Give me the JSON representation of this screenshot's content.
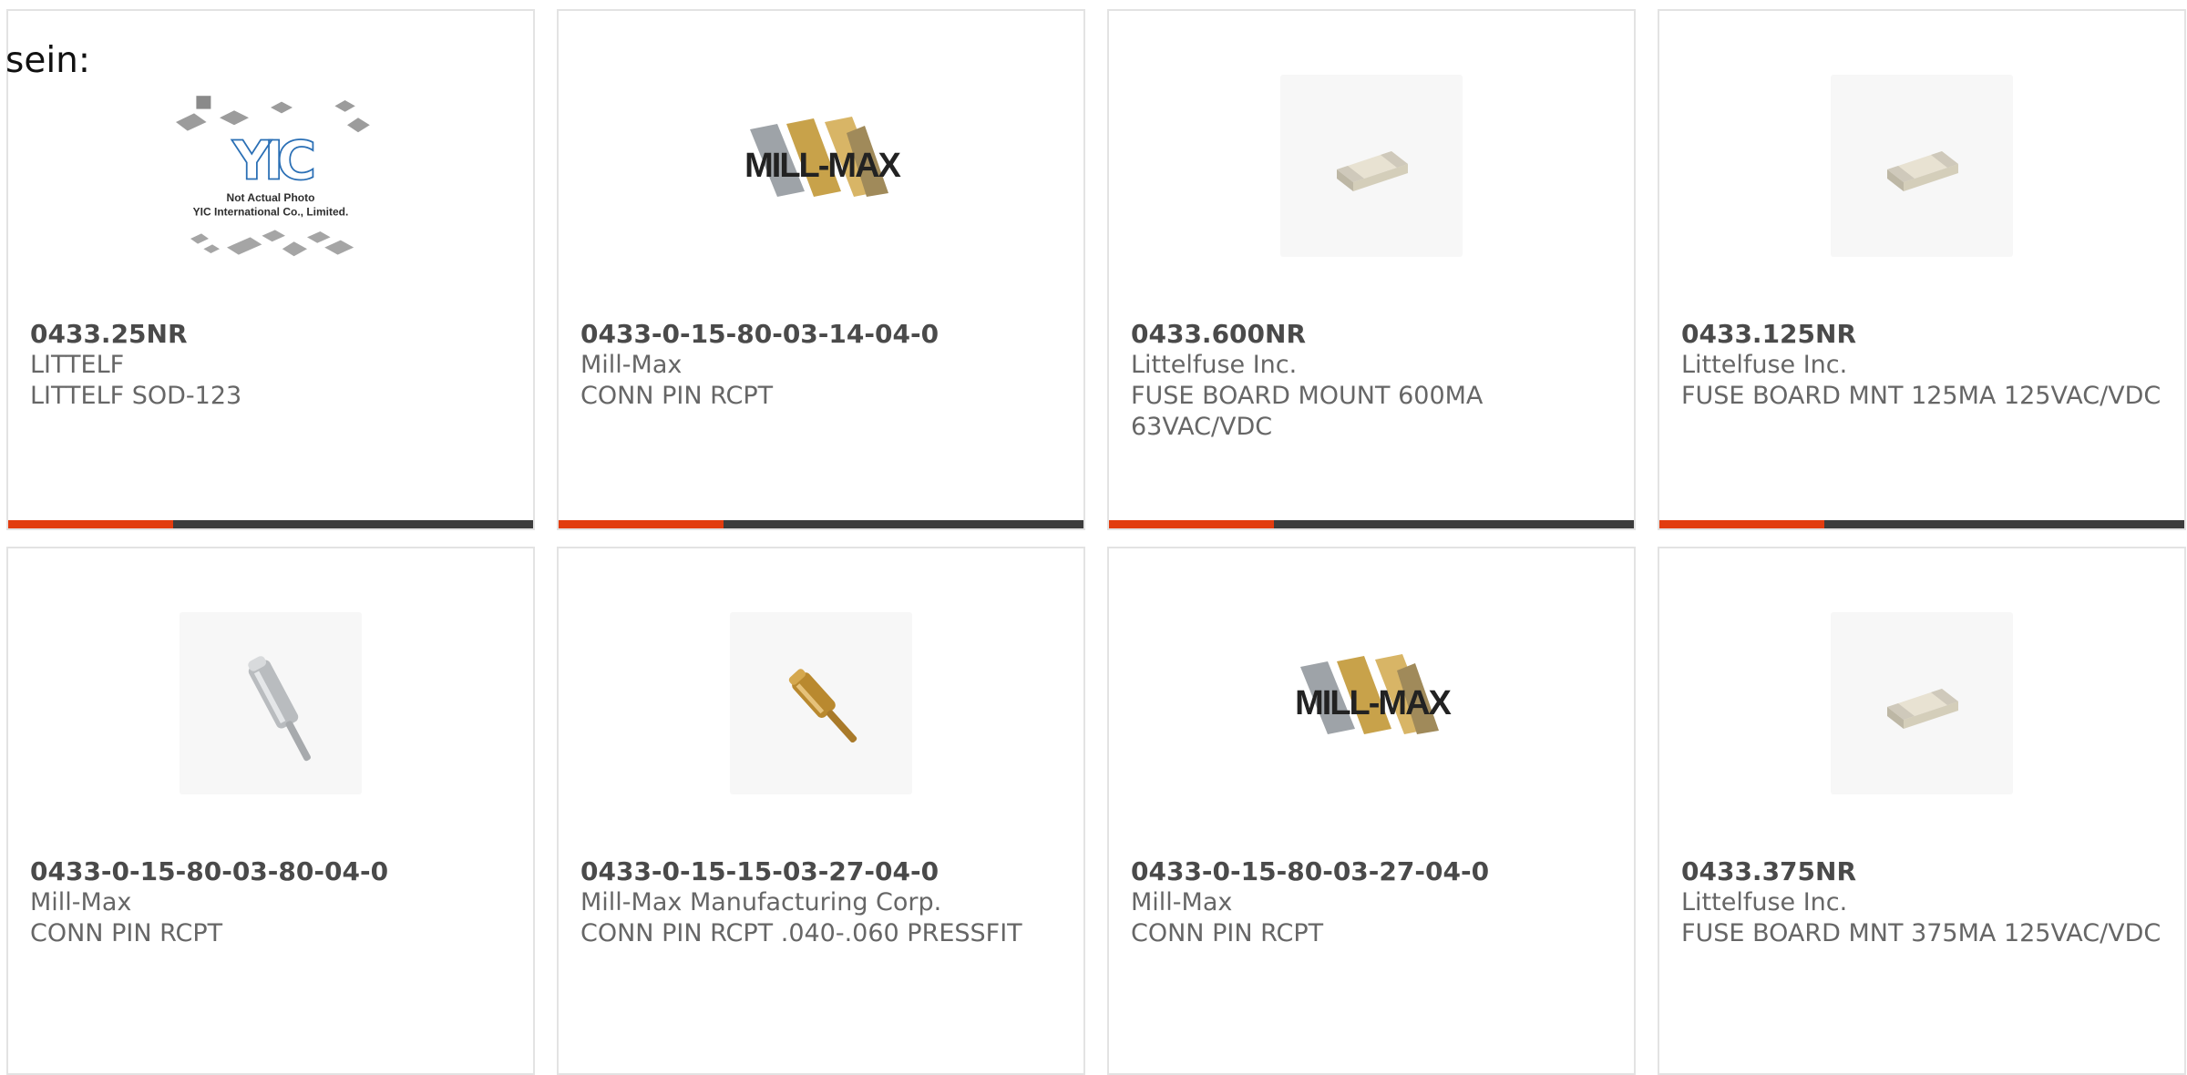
{
  "page_fragment": "sein:",
  "colors": {
    "accent": "#e23c0f",
    "bar": "#3c3c3c",
    "border": "#e3e3e3"
  },
  "cards": [
    {
      "part_number": "0433.25NR",
      "manufacturer": "LITTELF",
      "description": "LITTELF SOD-123",
      "image": {
        "type": "placeholder-photo-icon",
        "caption_line1": "Not Actual Photo",
        "caption_line2": "YIC International Co., Limited.",
        "logo": "YIC"
      }
    },
    {
      "part_number": "0433-0-15-80-03-14-04-0",
      "manufacturer": "Mill-Max",
      "description": "CONN PIN RCPT",
      "image": {
        "type": "mill-max-logo-icon",
        "logo_text": "MILL-MAX"
      }
    },
    {
      "part_number": "0433.600NR",
      "manufacturer": "Littelfuse Inc.",
      "description": "FUSE BOARD MOUNT 600MA 63VAC/VDC",
      "image": {
        "type": "smd-fuse-icon"
      }
    },
    {
      "part_number": "0433.125NR",
      "manufacturer": "Littelfuse Inc.",
      "description": "FUSE BOARD MNT 125MA 125VAC/VDC",
      "image": {
        "type": "smd-fuse-icon"
      }
    },
    {
      "part_number": "0433-0-15-80-03-80-04-0",
      "manufacturer": "Mill-Max",
      "description": "CONN PIN RCPT",
      "image": {
        "type": "silver-pin-icon"
      }
    },
    {
      "part_number": "0433-0-15-15-03-27-04-0",
      "manufacturer": "Mill-Max Manufacturing Corp.",
      "description": "CONN PIN RCPT .040-.060 PRESSFIT",
      "image": {
        "type": "gold-pin-icon"
      }
    },
    {
      "part_number": "0433-0-15-80-03-27-04-0",
      "manufacturer": "Mill-Max",
      "description": "CONN PIN RCPT",
      "image": {
        "type": "mill-max-logo-icon",
        "logo_text": "MILL-MAX"
      }
    },
    {
      "part_number": "0433.375NR",
      "manufacturer": "Littelfuse Inc.",
      "description": "FUSE BOARD MNT 375MA 125VAC/VDC",
      "image": {
        "type": "smd-fuse-icon"
      }
    }
  ]
}
